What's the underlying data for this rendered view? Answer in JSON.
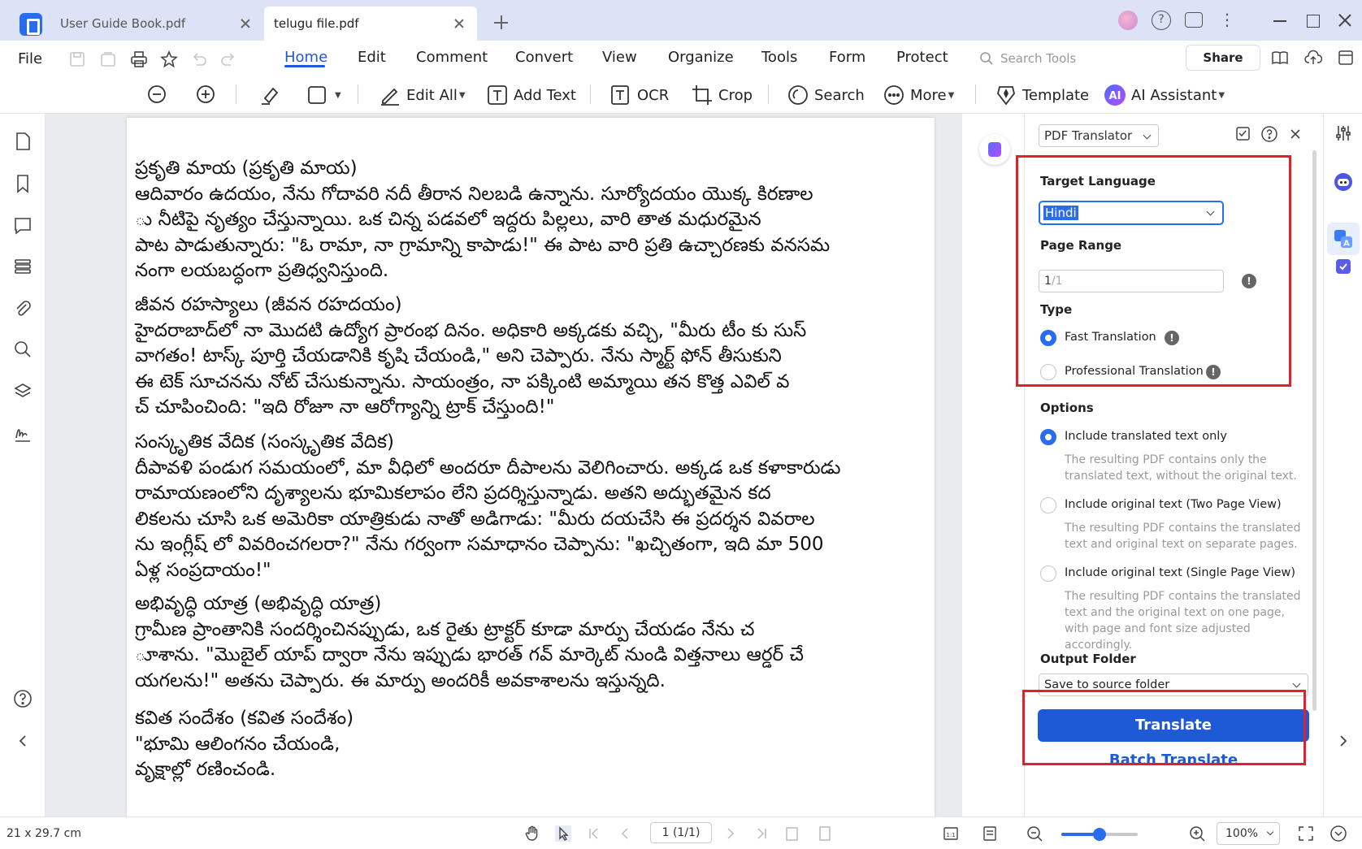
{
  "tabs": [
    {
      "label": "User Guide Book.pdf",
      "active": false
    },
    {
      "label": "telugu file.pdf",
      "active": true
    }
  ],
  "menu": {
    "file": "File",
    "tabs": [
      "Home",
      "Edit",
      "Comment",
      "Convert",
      "View",
      "Organize",
      "Tools",
      "Form",
      "Protect"
    ],
    "active_tab": "Home",
    "search_placeholder": "Search Tools",
    "share": "Share"
  },
  "toolbar": {
    "edit_all": "Edit All",
    "add_text": "Add Text",
    "ocr": "OCR",
    "crop": "Crop",
    "search": "Search",
    "more": "More",
    "template": "Template",
    "ai_assistant": "AI Assistant"
  },
  "document": {
    "paragraphs": [
      "ప్రకృతి మాయ (ప్రకృతి మాయ)\nఆదివారం ఉదయం, నేను గోదావరి నదీ తీరాన నిలబడి ఉన్నాను. సూర్యోదయం యొక్క కిరణాల\nు నీటిపై నృత్యం చేస్తున్నాయి. ఒక చిన్న పడవలో ఇద్దరు పిల్లలు, వారి తాత మధురమైన\nపాట పాడుతున్నారు: \"ఓ రామా, నా గ్రామాన్ని కాపాడు!\" ఈ పాట వారి ప్రతి ఉచ్చారణకు వనసమ\nనంగా లయబద్ధంగా ప్రతిధ్వనిస్తుంది.",
      "  జీవన రహస్యాలు (జీవన రహదయం)\nహైదరాబాద్‌లో నా మొదటి ఉద్యోగ ప్రారంభ దినం. అధికారి అక్కడకు వచ్చి, \"మీరు టీం కు సుస్\nవాగతం! టాస్క్ పూర్తి చేయడానికి కృషి చేయండి,\" అని చెప్పారు. నేను స్మార్ట్ ఫోన్ తీసుకుని\nఈ టెక్ సూచనను నోట్ చేసుకున్నాను. సాయంత్రం, నా పక్కింటి అమ్మాయి తన కొత్త ఎవిల్ వ\nచ్ చూపించింది: \"ఇది రోజూ నా ఆరోగ్యాన్ని ట్రాక్ చేస్తుంది!\"",
      "  సంస్కృతిక వేదిక (సంస్కృతిక వేదిక)\nదీపావళి పండుగ సమయంలో, మా వీధిలో అందరూ దీపాలను వెలిగించారు. అక్కడ ఒక కళాకారుడు\nరామాయణంలోని దృశ్యాలను భూమికలాపం లేని ప్రదర్శిస్తున్నాడు. అతని అద్భుతమైన కద\nలికలను చూసి ఒక అమెరికా యాత్రికుడు నాతో అడిగాడు: \"మీరు దయచేసి ఈ ప్రదర్శన వివరాల\nను ఇంగ్లీష్ లో వివరించగలరా?\" నేను గర్వంగా సమాధానం చెప్పాను: \"ఖచ్చితంగా, ఇది మా 500\nఏళ్ల సంప్రదాయం!\"",
      "  అభివృద్ధి యాత్ర (అభివృద్ధి యాత్ర)\nగ్రామీణ ప్రాంతానికి సందర్శించినప్పుడు, ఒక రైతు ట్రాక్టర్ కూడా మార్పు చేయడం నేను చ\nూశాను. \"మొబైల్ యాప్ ద్వారా నేను ఇప్పుడు భారత్ గవ్ మార్కెట్ నుండి విత్తనాలు ఆర్డర్ చే\nయగలను!\" అతను చెప్పారు. ఈ మార్పు అందరికీ అవకాశాలను ఇస్తున్నది.",
      "  కవిత సందేశం (కవిత సందేశం)\n\"భూమి ఆలింగనం చేయండి,\nవృక్షాల్లో రణించండి."
    ]
  },
  "panel": {
    "title": "PDF Translator",
    "target_language_label": "Target Language",
    "target_language": "Hindi",
    "page_range_label": "Page Range",
    "page_range_value": "1",
    "page_range_total": "/1",
    "type_label": "Type",
    "type_fast": "Fast Translation",
    "type_professional": "Professional Translation",
    "options_label": "Options",
    "opt1": "Include translated text only",
    "opt1_desc": "The resulting PDF contains only the translated text, without the original text.",
    "opt2": "Include original text (Two Page View)",
    "opt2_desc": "The resulting PDF contains the translated text and original text on separate pages.",
    "opt3": "Include original text (Single Page View)",
    "opt3_desc": "The resulting PDF contains the translated text and the original text on one page, with page and font size adjusted accordingly.",
    "output_folder_label": "Output Folder",
    "output_folder": "Save to source folder",
    "translate": "Translate",
    "batch_translate": "Batch Translate"
  },
  "status": {
    "page_size": "21 x 29.7 cm",
    "page_nav": "1 (1/1)",
    "zoom": "100%",
    "zoom_level": 0.5
  },
  "colors": {
    "accent": "#1f5ad6",
    "highlight_box": "#e0202e",
    "titlebar": "#dde3f6"
  }
}
